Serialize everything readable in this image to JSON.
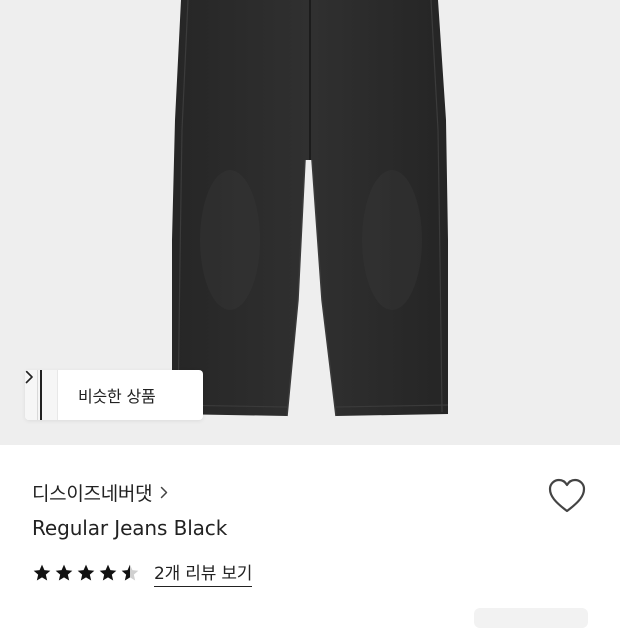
{
  "hero": {
    "image_subject": "black regular jeans",
    "background_color": "#eeeeee",
    "similar_button": {
      "label": "비슷한 상품"
    }
  },
  "product": {
    "brand": "디스이즈네버댓",
    "name": "Regular Jeans Black",
    "rating_stars": 4.5,
    "review_link": "2개 리뷰 보기"
  },
  "icons": {
    "brand_chevron": "chevron-right-icon",
    "wishlist": "heart-outline-icon",
    "similar_chevron": "chevron-right-icon",
    "star": "star-icon"
  },
  "colors": {
    "text": "#222222",
    "jeans": "#2b2b2b",
    "hero_bg": "#eeeeee"
  }
}
